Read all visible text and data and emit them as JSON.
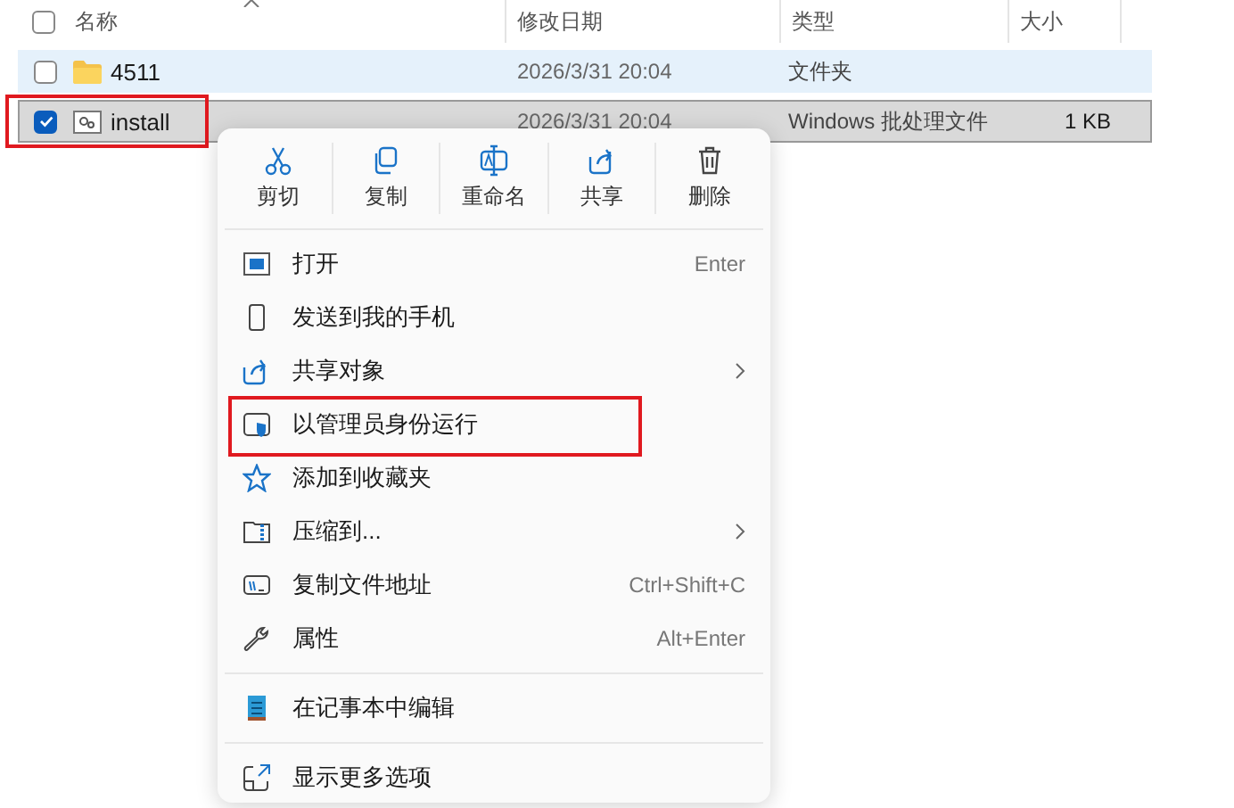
{
  "columns": [
    {
      "label": "名称"
    },
    {
      "label": "修改日期"
    },
    {
      "label": "类型"
    },
    {
      "label": "大小"
    }
  ],
  "header_checked": false,
  "rows": [
    {
      "name": "4511",
      "kind": "folder",
      "date": "2026/3/31 20:04",
      "type": "文件夹",
      "size": "",
      "checked": false,
      "selected": false,
      "hovered": true,
      "highlighted": false
    },
    {
      "name": "install",
      "kind": "batch",
      "date": "2026/3/31 20:04",
      "type": "Windows 批处理文件",
      "size": "1 KB",
      "checked": true,
      "selected": true,
      "hovered": false,
      "highlighted": true
    }
  ],
  "context_menu": {
    "actions": [
      {
        "label": "剪切"
      },
      {
        "label": "复制"
      },
      {
        "label": "重命名"
      },
      {
        "label": "共享"
      },
      {
        "label": "删除"
      }
    ],
    "sections": [
      [
        {
          "label": "打开",
          "shortcut": "Enter",
          "submenu": false,
          "highlighted": false
        },
        {
          "label": "发送到我的手机",
          "submenu": false,
          "highlighted": false
        },
        {
          "label": "共享对象",
          "submenu": true,
          "highlighted": false
        },
        {
          "label": "以管理员身份运行",
          "submenu": false,
          "highlighted": true
        },
        {
          "label": "添加到收藏夹",
          "submenu": false,
          "highlighted": false
        },
        {
          "label": "压缩到...",
          "submenu": true,
          "highlighted": false
        },
        {
          "label": "复制文件地址",
          "shortcut": "Ctrl+Shift+C",
          "submenu": false,
          "highlighted": false
        },
        {
          "label": "属性",
          "shortcut": "Alt+Enter",
          "submenu": false,
          "highlighted": false
        }
      ],
      [
        {
          "label": "在记事本中编辑",
          "submenu": false,
          "highlighted": false
        }
      ],
      [
        {
          "label": "显示更多选项",
          "submenu": false,
          "highlighted": false
        }
      ]
    ]
  }
}
